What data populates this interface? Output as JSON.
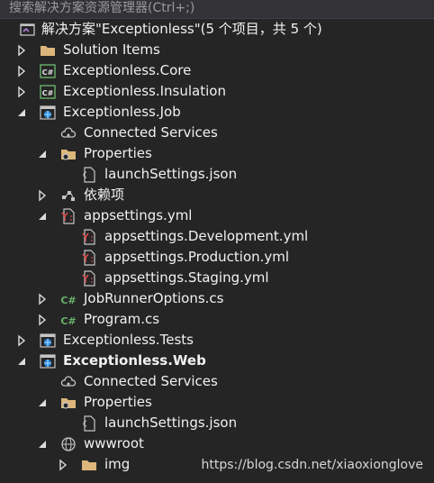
{
  "search_placeholder": "搜索解决方案资源管理器(Ctrl+;)",
  "watermark": "https://blog.csdn.net/xiaoxionglove",
  "colors": {
    "background": "#252526",
    "text": "#f1f1f1",
    "folder": "#dcb67a",
    "csharp": "#68b26a",
    "yml": "#d84b4b",
    "project": "#1e88e5"
  },
  "rows": [
    {
      "label": "解决方案\"Exceptionless\"(5 个项目，共 5 个)",
      "icon": "solution-icon",
      "expander": "none",
      "depth": 0,
      "bold": false
    },
    {
      "label": "Solution Items",
      "icon": "folder-icon",
      "expander": "collapsed",
      "depth": 0,
      "bold": false
    },
    {
      "label": "Exceptionless.Core",
      "icon": "csharp-project-icon",
      "expander": "collapsed",
      "depth": 0,
      "bold": false
    },
    {
      "label": "Exceptionless.Insulation",
      "icon": "csharp-project-icon",
      "expander": "collapsed",
      "depth": 0,
      "bold": false
    },
    {
      "label": "Exceptionless.Job",
      "icon": "web-project-icon",
      "expander": "expanded",
      "depth": 0,
      "bold": false
    },
    {
      "label": "Connected Services",
      "icon": "connected-services-icon",
      "expander": "none",
      "depth": 1,
      "bold": false
    },
    {
      "label": "Properties",
      "icon": "properties-folder-icon",
      "expander": "expanded",
      "depth": 1,
      "bold": false
    },
    {
      "label": "launchSettings.json",
      "icon": "json-file-icon",
      "expander": "none",
      "depth": 2,
      "bold": false
    },
    {
      "label": "依赖项",
      "icon": "dependencies-icon",
      "expander": "collapsed",
      "depth": 1,
      "bold": false
    },
    {
      "label": "appsettings.yml",
      "icon": "yml-file-icon",
      "expander": "expanded",
      "depth": 1,
      "bold": false
    },
    {
      "label": "appsettings.Development.yml",
      "icon": "yml-file-icon",
      "expander": "none",
      "depth": 2,
      "bold": false
    },
    {
      "label": "appsettings.Production.yml",
      "icon": "yml-file-icon",
      "expander": "none",
      "depth": 2,
      "bold": false
    },
    {
      "label": "appsettings.Staging.yml",
      "icon": "yml-file-icon",
      "expander": "none",
      "depth": 2,
      "bold": false
    },
    {
      "label": "JobRunnerOptions.cs",
      "icon": "csharp-file-icon",
      "expander": "collapsed",
      "depth": 1,
      "bold": false
    },
    {
      "label": "Program.cs",
      "icon": "csharp-file-icon",
      "expander": "collapsed",
      "depth": 1,
      "bold": false
    },
    {
      "label": "Exceptionless.Tests",
      "icon": "web-project-icon",
      "expander": "collapsed",
      "depth": 0,
      "bold": false
    },
    {
      "label": "Exceptionless.Web",
      "icon": "web-project-icon",
      "expander": "expanded",
      "depth": 0,
      "bold": true
    },
    {
      "label": "Connected Services",
      "icon": "connected-services-icon",
      "expander": "none",
      "depth": 1,
      "bold": false
    },
    {
      "label": "Properties",
      "icon": "properties-folder-icon",
      "expander": "expanded",
      "depth": 1,
      "bold": false
    },
    {
      "label": "launchSettings.json",
      "icon": "json-file-icon",
      "expander": "none",
      "depth": 2,
      "bold": false
    },
    {
      "label": "wwwroot",
      "icon": "globe-icon",
      "expander": "expanded",
      "depth": 1,
      "bold": false
    },
    {
      "label": "img",
      "icon": "folder-icon",
      "expander": "collapsed",
      "depth": 2,
      "bold": false
    }
  ]
}
